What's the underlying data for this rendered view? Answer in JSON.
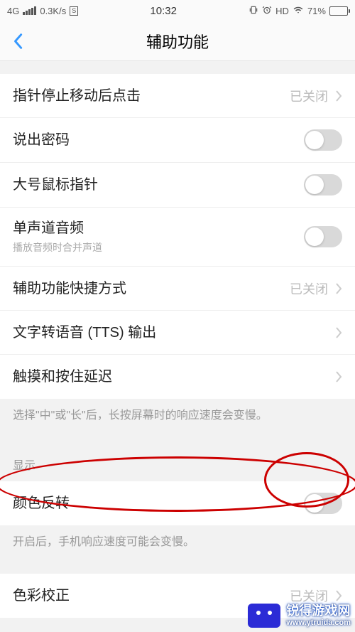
{
  "status": {
    "network": "4G",
    "speed": "0.3K/s",
    "sim": "S",
    "time": "10:32",
    "hd": "HD",
    "battery_pct": "71%"
  },
  "nav": {
    "title": "辅助功能"
  },
  "rows": {
    "pointer_click": {
      "label": "指针停止移动后点击",
      "value": "已关闭"
    },
    "speak_pwd": {
      "label": "说出密码"
    },
    "large_cursor": {
      "label": "大号鼠标指针"
    },
    "mono_audio": {
      "label": "单声道音频",
      "sub": "播放音频时合并声道"
    },
    "a11y_shortcut": {
      "label": "辅助功能快捷方式",
      "value": "已关闭"
    },
    "tts": {
      "label": "文字转语音 (TTS) 输出"
    },
    "touch_hold": {
      "label": "触摸和按住延迟"
    },
    "invert": {
      "label": "颜色反转"
    },
    "color_correct": {
      "label": "色彩校正",
      "value": "已关闭"
    }
  },
  "notes": {
    "touch_hold_note": "选择\"中\"或\"长\"后，长按屏幕时的响应速度会变慢。",
    "display_header": "显示",
    "invert_note": "开启后，手机响应速度可能会变慢。"
  },
  "watermark": {
    "line1": "锐得游戏网",
    "line2": "www.ytruida.com"
  }
}
